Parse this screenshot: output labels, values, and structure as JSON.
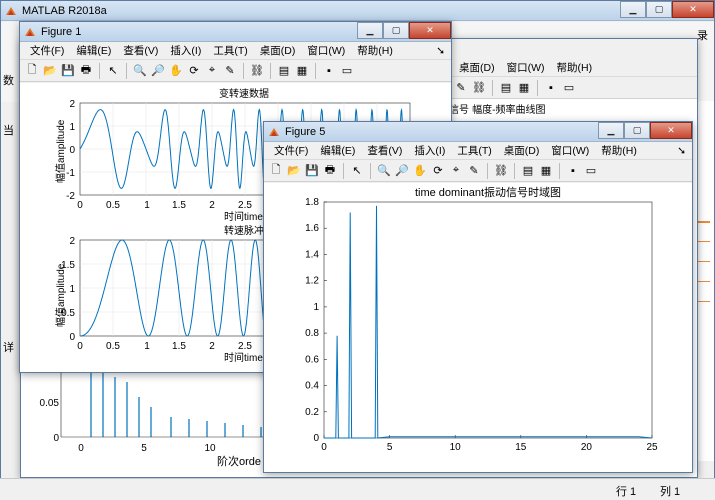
{
  "main_window": {
    "title": "MATLAB R2018a",
    "toolbar_right_text": "录",
    "left_labels": [
      "数",
      "当",
      "详"
    ]
  },
  "figure1": {
    "title": "Figure 1",
    "menu": [
      "文件(F)",
      "编辑(E)",
      "查看(V)",
      "插入(I)",
      "工具(T)",
      "桌面(D)",
      "窗口(W)",
      "帮助(H)"
    ],
    "plot_top": {
      "title": "变转速数据",
      "xlabel": "时间time",
      "ylabel": "幅值amplitude",
      "xticks": [
        "0",
        "0.5",
        "1",
        "1.5",
        "2",
        "2.5"
      ],
      "yticks": [
        "2",
        "1",
        "0",
        "-1",
        "-2"
      ]
    },
    "plot_bottom": {
      "title": "转速脉冲",
      "xlabel": "时间time",
      "ylabel": "幅值amplitude",
      "xticks": [
        "0",
        "0.5",
        "1",
        "1.5",
        "2",
        "2.5"
      ],
      "yticks": [
        "2",
        "1.5",
        "1",
        "0.5",
        "0"
      ]
    }
  },
  "bg_figure": {
    "menu": [
      "桌面(D)",
      "窗口(W)",
      "帮助(H)"
    ],
    "title_fragment": "真信号 幅度-频率曲线图",
    "xlabel": "阶次orde",
    "xticks": [
      "0",
      "5",
      "10"
    ],
    "yticks": [
      "0.05",
      "0"
    ]
  },
  "figure5": {
    "title": "Figure 5",
    "menu": [
      "文件(F)",
      "编辑(E)",
      "查看(V)",
      "插入(I)",
      "工具(T)",
      "桌面(D)",
      "窗口(W)",
      "帮助(H)"
    ]
  },
  "status": {
    "row": "行 1",
    "col": "列 1"
  },
  "chart_data": {
    "type": "line",
    "title": "time dominant振动信号时域图",
    "xlabel": "",
    "ylabel": "",
    "xlim": [
      0,
      25
    ],
    "ylim": [
      0,
      1.8
    ],
    "xticks": [
      0,
      5,
      10,
      15,
      20,
      25
    ],
    "yticks": [
      0,
      0.2,
      0.4,
      0.6,
      0.8,
      1,
      1.2,
      1.4,
      1.6,
      1.8
    ],
    "series": [
      {
        "x": [
          0,
          0.9,
          1,
          1.1,
          1.9,
          2,
          2.1,
          3.9,
          4,
          4.1,
          5,
          6,
          7,
          8,
          9,
          10,
          11,
          12,
          13,
          14,
          15,
          16,
          17,
          18,
          19,
          20,
          21,
          22,
          23,
          24,
          25
        ],
        "values": [
          0,
          0,
          0.78,
          0,
          0,
          1.72,
          0,
          0,
          1.77,
          0,
          0.01,
          0.01,
          0.01,
          0.01,
          0.01,
          0.01,
          0.01,
          0.01,
          0.01,
          0.01,
          0.01,
          0.01,
          0.01,
          0.01,
          0.01,
          0.01,
          0.01,
          0.01,
          0.01,
          0.01,
          0
        ]
      }
    ],
    "line_color": "#0072bd"
  }
}
